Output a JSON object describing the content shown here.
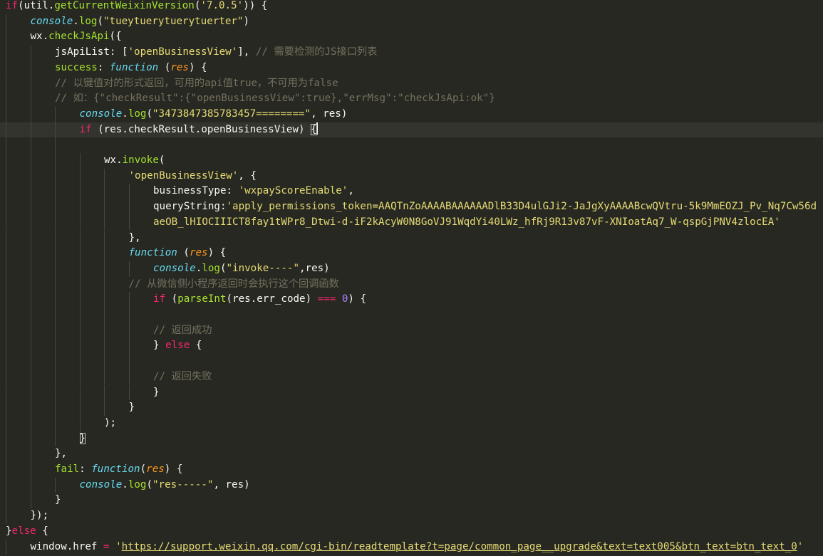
{
  "editor": {
    "background": "#272822",
    "active_line": 8,
    "lines": [
      {
        "indent": 0,
        "tokens": [
          [
            "kw",
            "if"
          ],
          [
            "pl",
            "(util."
          ],
          [
            "fn",
            "getCurrentWeixinVersion"
          ],
          [
            "pl",
            "("
          ],
          [
            "str",
            "'7.0.5'"
          ],
          [
            "pl",
            ")) {"
          ]
        ]
      },
      {
        "indent": 1,
        "tokens": [
          [
            "obj",
            "console"
          ],
          [
            "pl",
            "."
          ],
          [
            "fn",
            "log"
          ],
          [
            "pl",
            "("
          ],
          [
            "str",
            "\"tueytuerytuerytuerter\""
          ],
          [
            "pl",
            ")"
          ]
        ]
      },
      {
        "indent": 1,
        "tokens": [
          [
            "pl",
            "wx."
          ],
          [
            "fn",
            "checkJsApi"
          ],
          [
            "pl",
            "({"
          ]
        ]
      },
      {
        "indent": 2,
        "tokens": [
          [
            "pl",
            "jsApiList: ["
          ],
          [
            "str",
            "'openBusinessView'"
          ],
          [
            "pl",
            "], "
          ],
          [
            "cm",
            "// 需要检测的JS接口列表"
          ]
        ]
      },
      {
        "indent": 2,
        "tokens": [
          [
            "key",
            "success"
          ],
          [
            "pl",
            ": "
          ],
          [
            "obj",
            "function"
          ],
          [
            "pl",
            " ("
          ],
          [
            "par",
            "res"
          ],
          [
            "pl",
            ") {"
          ]
        ]
      },
      {
        "indent": 2,
        "tokens": [
          [
            "cm",
            "// 以键值对的形式返回，可用的api值true，不可用为false"
          ]
        ]
      },
      {
        "indent": 2,
        "tokens": [
          [
            "cm",
            "// 如：{\"checkResult\":{\"openBusinessView\":true},\"errMsg\":\"checkJsApi:ok\"}"
          ]
        ]
      },
      {
        "indent": 3,
        "tokens": [
          [
            "obj",
            "console"
          ],
          [
            "pl",
            "."
          ],
          [
            "fn",
            "log"
          ],
          [
            "pl",
            "("
          ],
          [
            "str",
            "\"3473847385783457========\""
          ],
          [
            "pl",
            ", res)"
          ]
        ]
      },
      {
        "indent": 3,
        "tokens": [
          [
            "kw",
            "if"
          ],
          [
            "pl",
            " (res.checkResult.openBusinessView) "
          ],
          [
            "br",
            "{"
          ],
          [
            "caret",
            ""
          ]
        ]
      },
      {
        "indent": 3,
        "tokens": []
      },
      {
        "indent": 4,
        "tokens": [
          [
            "pl",
            "wx."
          ],
          [
            "fn",
            "invoke"
          ],
          [
            "pl",
            "("
          ]
        ]
      },
      {
        "indent": 5,
        "tokens": [
          [
            "str",
            "'openBusinessView'"
          ],
          [
            "pl",
            ", {"
          ]
        ]
      },
      {
        "indent": 6,
        "tokens": [
          [
            "pl",
            "businessType: "
          ],
          [
            "str",
            "'wxpayScoreEnable'"
          ],
          [
            "pl",
            ","
          ]
        ]
      },
      {
        "indent": 6,
        "tokens": [
          [
            "pl",
            "queryString:"
          ],
          [
            "str",
            "'apply_permissions_token=AAQTnZoAAAABAAAAAADlB33D4ulGJi2-JaJgXyAAAABcwQVtru-5k9MmEOZJ_Pv_Nq7Cw56d"
          ]
        ]
      },
      {
        "indent": 6,
        "tokens": [
          [
            "str",
            "aeOB_lHIOCIIICT8fay1tWPr8_Dtwi-d-iF2kAcyW0N8GoVJ91WqdYi40LWz_hfRj9R13v87vF-XNIoatAq7_W-qspGjPNV4zlocEA'"
          ]
        ]
      },
      {
        "indent": 5,
        "tokens": [
          [
            "pl",
            "},"
          ]
        ]
      },
      {
        "indent": 5,
        "tokens": [
          [
            "obj",
            "function"
          ],
          [
            "pl",
            " ("
          ],
          [
            "par",
            "res"
          ],
          [
            "pl",
            ") {"
          ]
        ]
      },
      {
        "indent": 6,
        "tokens": [
          [
            "obj",
            "console"
          ],
          [
            "pl",
            "."
          ],
          [
            "fn",
            "log"
          ],
          [
            "pl",
            "("
          ],
          [
            "str",
            "\"invoke----\""
          ],
          [
            "pl",
            ",res)"
          ]
        ]
      },
      {
        "indent": 5,
        "tokens": [
          [
            "cm",
            "// 从微信侧小程序返回时会执行这个回调函数"
          ]
        ]
      },
      {
        "indent": 6,
        "tokens": [
          [
            "kw",
            "if"
          ],
          [
            "pl",
            " ("
          ],
          [
            "fn",
            "parseInt"
          ],
          [
            "pl",
            "(res.err_code) "
          ],
          [
            "op",
            "==="
          ],
          [
            "pl",
            " "
          ],
          [
            "num",
            "0"
          ],
          [
            "pl",
            ") {"
          ]
        ]
      },
      {
        "indent": 6,
        "tokens": []
      },
      {
        "indent": 6,
        "tokens": [
          [
            "cm",
            "// 返回成功"
          ]
        ]
      },
      {
        "indent": 6,
        "tokens": [
          [
            "pl",
            "} "
          ],
          [
            "kw",
            "else"
          ],
          [
            "pl",
            " {"
          ]
        ]
      },
      {
        "indent": 6,
        "tokens": []
      },
      {
        "indent": 6,
        "tokens": [
          [
            "cm",
            "// 返回失败"
          ]
        ]
      },
      {
        "indent": 6,
        "tokens": [
          [
            "pl",
            "}"
          ]
        ]
      },
      {
        "indent": 5,
        "tokens": [
          [
            "pl",
            "}"
          ]
        ]
      },
      {
        "indent": 4,
        "tokens": [
          [
            "pl",
            ");"
          ]
        ]
      },
      {
        "indent": 3,
        "tokens": [
          [
            "br",
            "}"
          ]
        ]
      },
      {
        "indent": 2,
        "tokens": [
          [
            "pl",
            "},"
          ]
        ]
      },
      {
        "indent": 2,
        "tokens": [
          [
            "key",
            "fail"
          ],
          [
            "pl",
            ": "
          ],
          [
            "obj",
            "function"
          ],
          [
            "pl",
            "("
          ],
          [
            "par",
            "res"
          ],
          [
            "pl",
            ") {"
          ]
        ]
      },
      {
        "indent": 3,
        "tokens": [
          [
            "obj",
            "console"
          ],
          [
            "pl",
            "."
          ],
          [
            "fn",
            "log"
          ],
          [
            "pl",
            "("
          ],
          [
            "str",
            "\"res-----\""
          ],
          [
            "pl",
            ", res)"
          ]
        ]
      },
      {
        "indent": 2,
        "tokens": [
          [
            "pl",
            "}"
          ]
        ]
      },
      {
        "indent": 1,
        "tokens": [
          [
            "pl",
            "});"
          ]
        ]
      },
      {
        "indent": 0,
        "tokens": [
          [
            "pl",
            "}"
          ],
          [
            "kw",
            "else"
          ],
          [
            "pl",
            " {"
          ]
        ]
      },
      {
        "indent": 1,
        "tokens": [
          [
            "pl",
            "window.href "
          ],
          [
            "op",
            "="
          ],
          [
            "pl",
            " "
          ],
          [
            "str",
            "'"
          ],
          [
            "url",
            "https://support.weixin.qq.com/cgi-bin/readtemplate?t=page/common_page__upgrade&text=text005&btn_text=btn_text_0"
          ],
          [
            "str",
            "'"
          ]
        ]
      }
    ]
  }
}
